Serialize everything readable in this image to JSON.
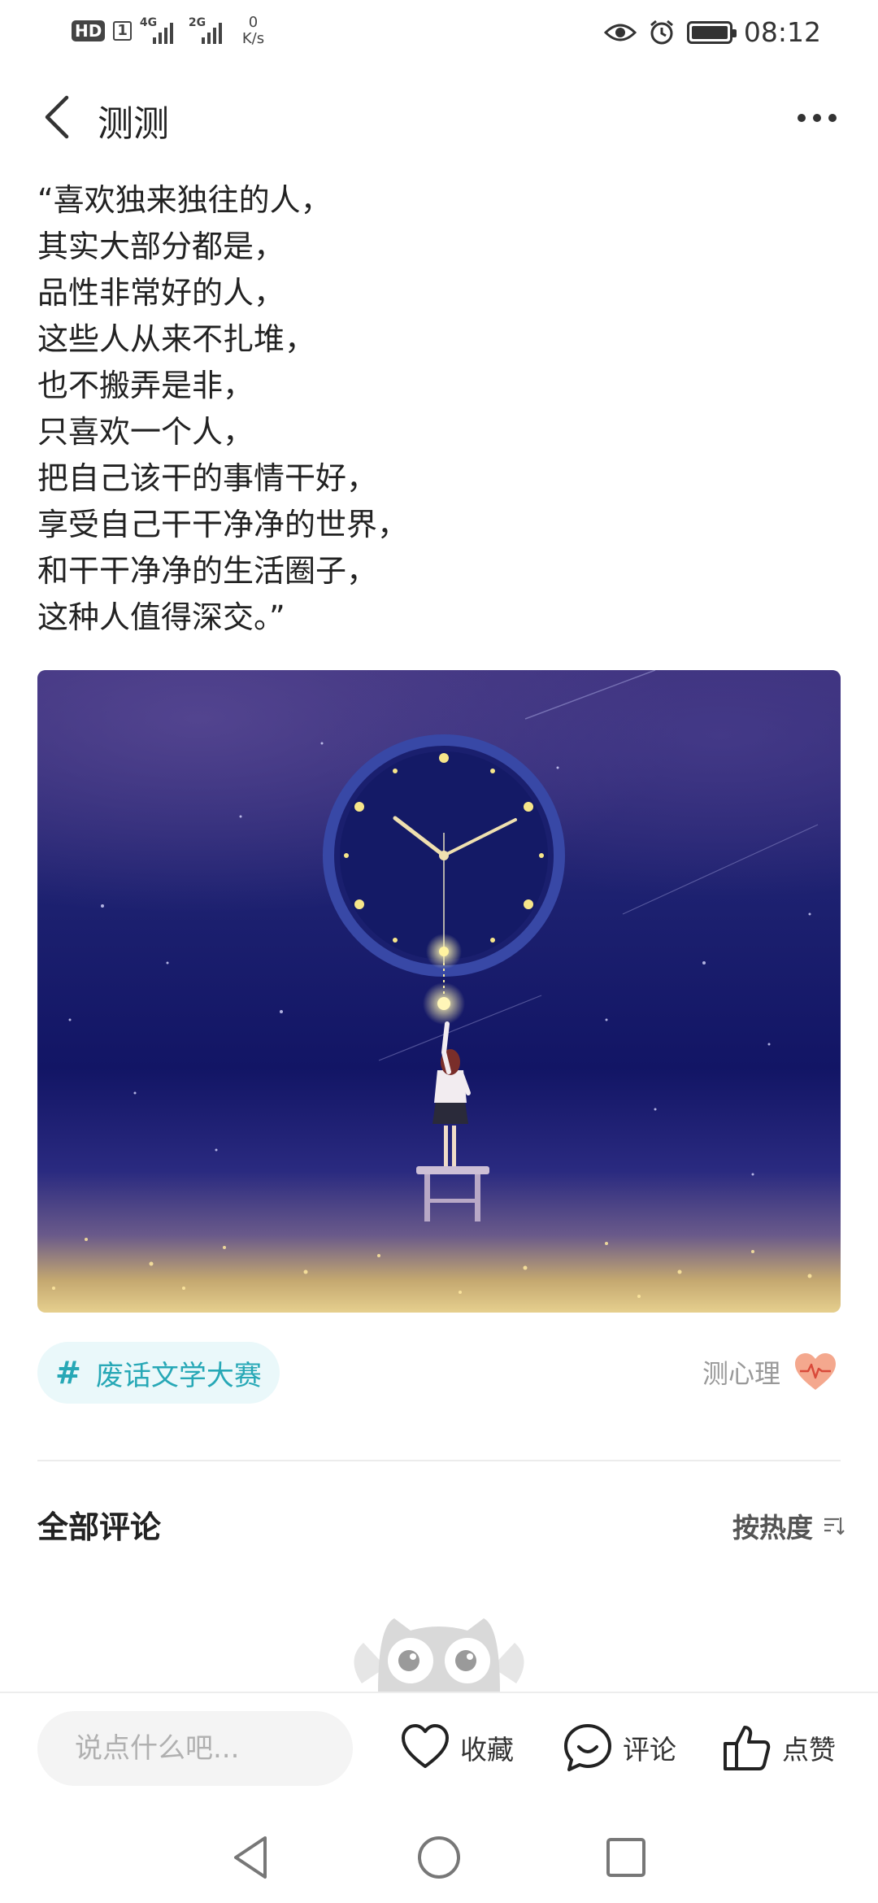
{
  "status_bar": {
    "hd": "HD",
    "sim": "1",
    "net1": "4G",
    "net2": "2G",
    "speed_value": "0",
    "speed_unit": "K/s",
    "time": "08:12"
  },
  "nav": {
    "title": "测测"
  },
  "post": {
    "lines": [
      "“喜欢独来独往的人，",
      "其实大部分都是，",
      "品性非常好的人，",
      "这些人从来不扎堆，",
      "也不搬弄是非，",
      "只喜欢一个人，",
      "把自己该干的事情干好，",
      "享受自己干干净净的世界，",
      "和干干净净的生活圈子，",
      "这种人值得深交。”"
    ]
  },
  "tag": {
    "hash": "#",
    "label": "废话文学大赛"
  },
  "source": {
    "label": "测心理"
  },
  "comments": {
    "title": "全部评论",
    "sort_label": "按热度"
  },
  "action_bar": {
    "input_placeholder": "说点什么吧...",
    "favorite_label": "收藏",
    "comment_label": "评论",
    "like_label": "点赞"
  },
  "colors": {
    "accent_teal": "#27a8b6",
    "tag_bg": "#eaf8fa",
    "source_badge": "#f08a6c"
  }
}
